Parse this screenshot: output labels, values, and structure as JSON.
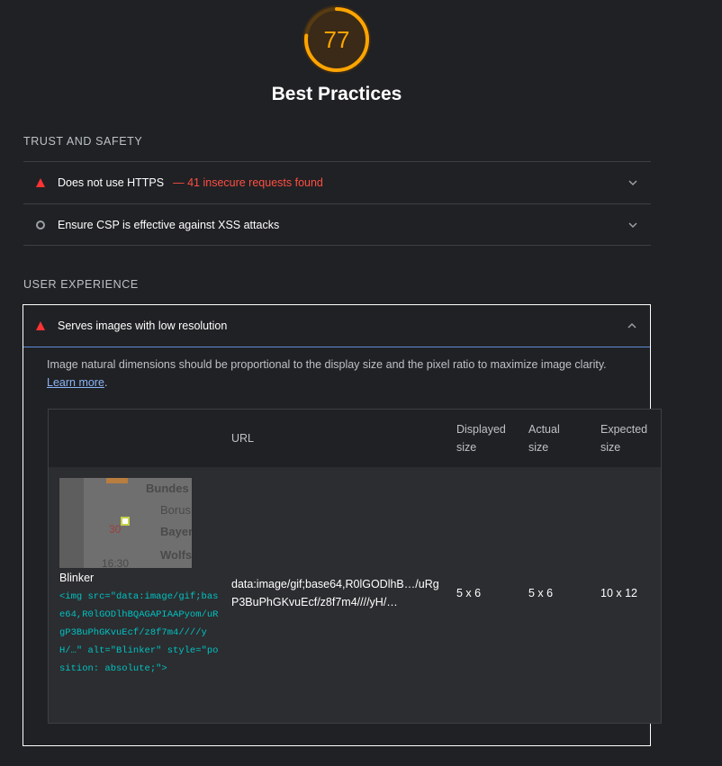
{
  "category": {
    "score": "77",
    "score_fraction": 0.77,
    "title": "Best Practices",
    "accent_color": "#ffa400"
  },
  "groups": [
    {
      "title": "Trust and Safety",
      "audits": [
        {
          "status_icon": "fail-triangle-icon",
          "title": "Does not use HTTPS",
          "display_value": "— 41 insecure requests found"
        },
        {
          "status_icon": "info-circle-icon",
          "title": "Ensure CSP is effective against XSS attacks",
          "display_value": ""
        }
      ]
    },
    {
      "title": "User Experience",
      "audits": [
        {
          "status_icon": "fail-triangle-icon",
          "title": "Serves images with low resolution",
          "expanded": true,
          "description": "Image natural dimensions should be proportional to the display size and the pixel ratio to maximize image clarity.",
          "learn_more": "Learn more",
          "table": {
            "headers": [
              "",
              "URL",
              "Displayed size",
              "Actual size",
              "Expected size"
            ],
            "rows": [
              {
                "thumbnail_texts": [
                  "Bundes",
                  "Borus",
                  "Bayer",
                  "Wolfs",
                  "30",
                  "16:30"
                ],
                "node_label": "Blinker",
                "node_snippet": "<img src=\"data:image/gif;base64,R0lGODlhBQAGAPIAAPyom/uRgP3BuPhGKvuEcf/z8f7m4////yH/…\" alt=\"Blinker\" style=\"position: absolute;\">",
                "url": "data:image/gif;base64,R0lGODlhB…/uRgP3BuPhGKvuEcf/z8f7m4////yH/…",
                "displayed_size": "5 x 6",
                "actual_size": "5 x 6",
                "expected_size": "10 x 12"
              }
            ]
          }
        }
      ]
    }
  ],
  "colors": {
    "fail": "#ff3333",
    "fail_text": "#ff4e42",
    "link": "#8ab4f8",
    "code": "#00c2c2"
  }
}
